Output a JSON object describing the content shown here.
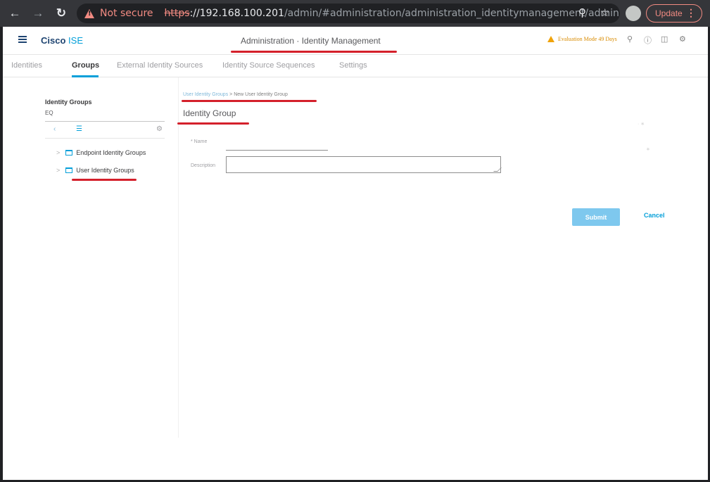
{
  "browser": {
    "not_secure": "Not secure",
    "url_scheme": "https",
    "url_host": "://192.168.100.201",
    "url_path": "/admin/#administration/administration_identitymanagement/administr...",
    "update_label": "Update"
  },
  "app": {
    "brand_primary": "Cisco",
    "brand_secondary": "ISE",
    "page_heading": "Administration · Identity Management",
    "evaluation_notice": "Evaluation Mode 49 Days"
  },
  "tabs": [
    {
      "label": "Identities"
    },
    {
      "label": "Groups"
    },
    {
      "label": "External Identity Sources"
    },
    {
      "label": "Identity Source Sequences"
    },
    {
      "label": "Settings"
    }
  ],
  "sidebar": {
    "title": "Identity Groups",
    "search_placeholder": "EQ",
    "items": [
      {
        "label": "Endpoint Identity Groups"
      },
      {
        "label": "User Identity Groups"
      }
    ]
  },
  "breadcrumb": {
    "parent": "User Identity Groups",
    "separator": ">",
    "current": "New User Identity Group"
  },
  "form": {
    "title": "Identity Group",
    "name_label": "* Name",
    "name_value": "",
    "description_label": "Description",
    "description_value": "",
    "submit_label": "Submit",
    "cancel_label": "Cancel"
  },
  "colors": {
    "accent": "#049fd9",
    "brand": "#1e4471",
    "annotation_red": "#d4202b",
    "warning": "#f28b82"
  },
  "icons": [
    "back-arrow-icon",
    "forward-arrow-icon",
    "reload-icon",
    "warning-icon",
    "zoom-icon",
    "star-icon",
    "profile-avatar-icon",
    "menu-dots-icon",
    "hamburger-icon",
    "search-icon",
    "help-icon",
    "notifications-icon",
    "gear-icon",
    "collapse-icon",
    "tree-icon",
    "folder-icon",
    "chevron-right-icon"
  ]
}
